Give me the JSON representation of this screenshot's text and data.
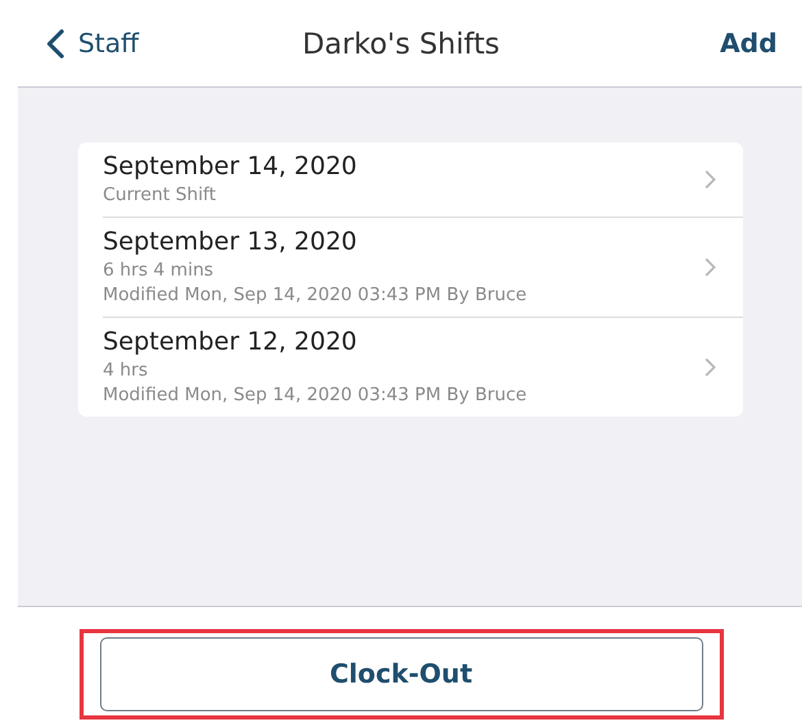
{
  "nav": {
    "back_label": "Staff",
    "title": "Darko's Shifts",
    "action": "Add"
  },
  "shifts": [
    {
      "date": "September 14, 2020",
      "lines": [
        "Current Shift"
      ]
    },
    {
      "date": "September 13, 2020",
      "lines": [
        "6 hrs 4 mins",
        "Modified Mon, Sep 14, 2020 03:43 PM By Bruce"
      ]
    },
    {
      "date": "September 12, 2020",
      "lines": [
        "4 hrs",
        "Modified Mon, Sep 14, 2020 03:43 PM By Bruce"
      ]
    }
  ],
  "footer": {
    "button": "Clock-Out",
    "highlighted": true
  }
}
